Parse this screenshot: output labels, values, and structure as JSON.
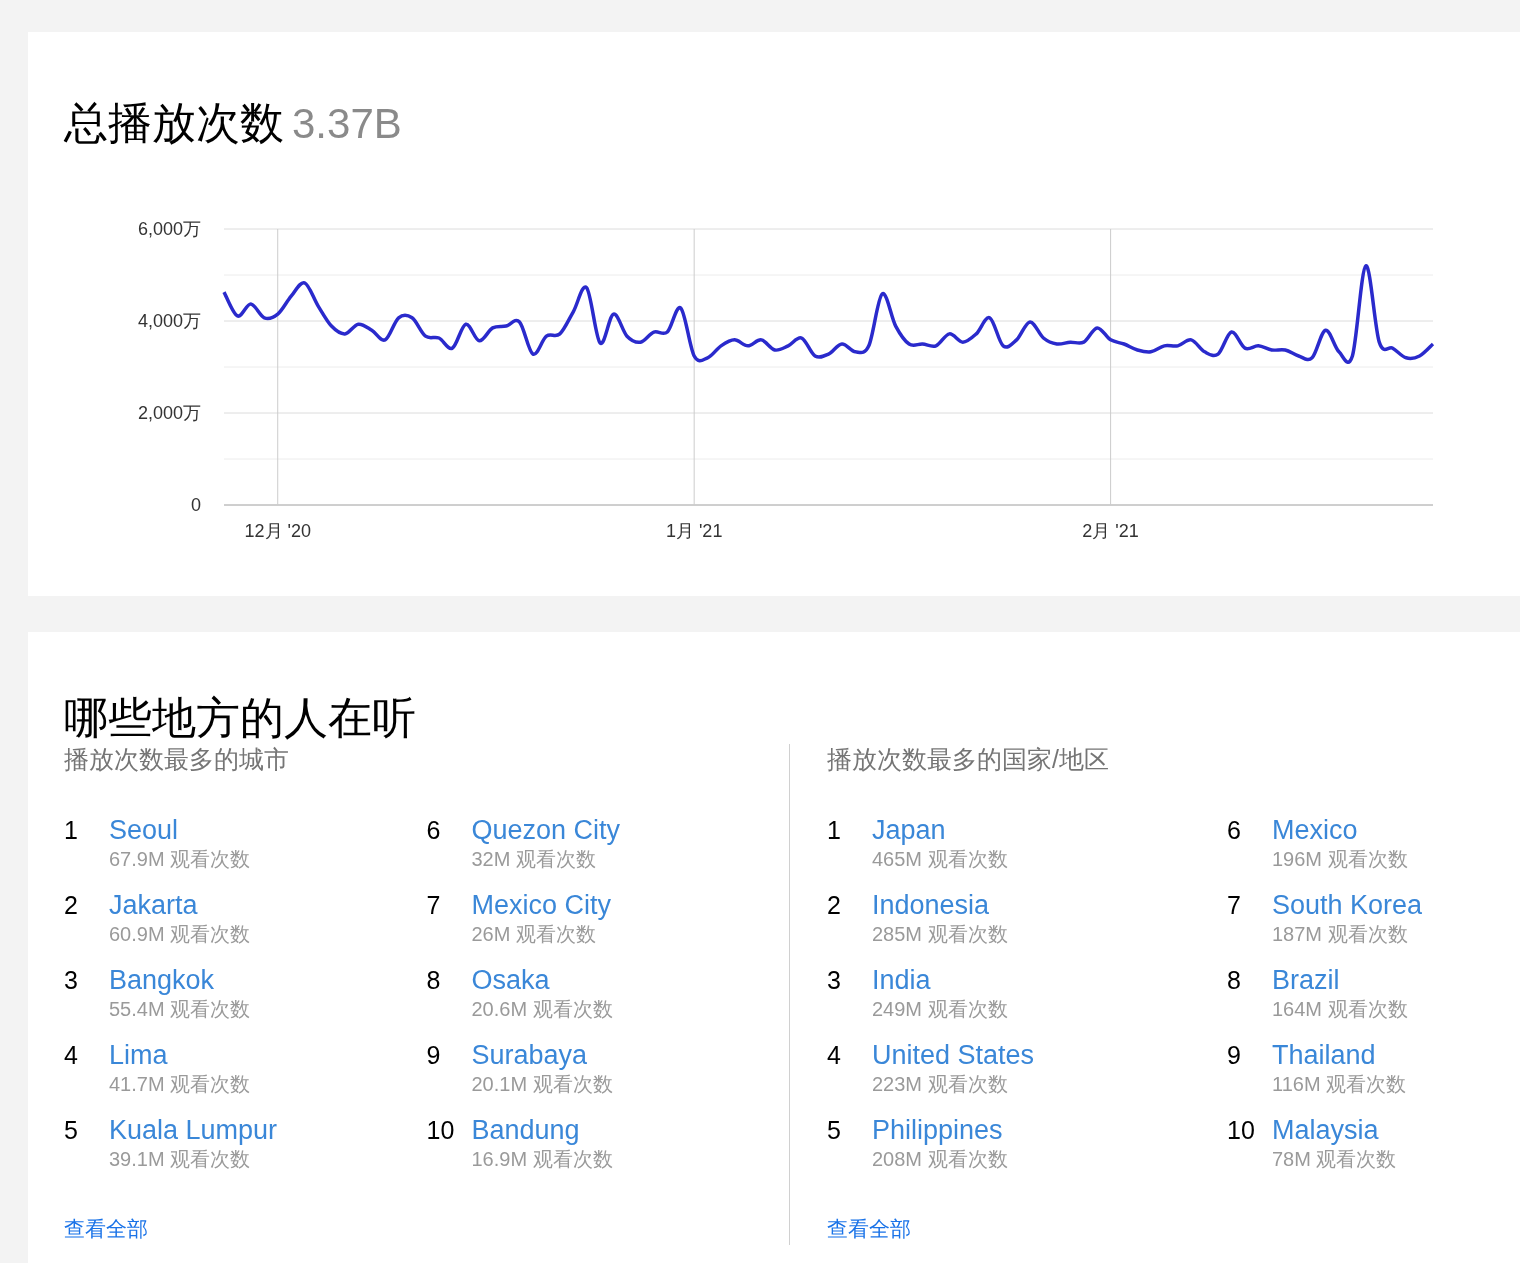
{
  "plays": {
    "title": "总播放次数",
    "total": "3.37B",
    "chart_data": {
      "type": "line",
      "grid": true,
      "ylim": [
        0,
        6000
      ],
      "categories": [
        null,
        null,
        null,
        null,
        "12月 '20",
        null,
        null,
        null,
        null,
        null,
        null,
        null,
        null,
        null,
        null,
        null,
        null,
        null,
        null,
        null,
        null,
        null,
        null,
        null,
        null,
        null,
        null,
        null,
        null,
        null,
        null,
        null,
        null,
        null,
        null,
        "1月 '21",
        null,
        null,
        null,
        null,
        null,
        null,
        null,
        null,
        null,
        null,
        null,
        null,
        null,
        null,
        null,
        null,
        null,
        null,
        null,
        null,
        null,
        null,
        null,
        null,
        null,
        null,
        null,
        null,
        null,
        null,
        "2月 '21",
        null,
        null,
        null,
        null,
        null,
        null,
        null,
        null,
        null,
        null,
        null,
        null,
        null,
        null,
        null,
        null,
        null,
        null,
        null,
        null,
        null,
        null,
        null,
        null
      ],
      "yticks": [
        {
          "value": 0,
          "label": "0"
        },
        {
          "value": 2000,
          "label": "2,000万"
        },
        {
          "value": 4000,
          "label": "4,000万"
        },
        {
          "value": 6000,
          "label": "6,000万"
        }
      ],
      "series": [
        {
          "color": "#2a2acc",
          "values": [
            4630,
            4110,
            4370,
            4070,
            4150,
            4540,
            4830,
            4330,
            3890,
            3720,
            3930,
            3800,
            3590,
            4070,
            4070,
            3670,
            3630,
            3410,
            3930,
            3570,
            3850,
            3890,
            3980,
            3280,
            3670,
            3720,
            4200,
            4720,
            3520,
            4150,
            3670,
            3540,
            3760,
            3760,
            4280,
            3240,
            3200,
            3460,
            3590,
            3460,
            3590,
            3370,
            3460,
            3630,
            3240,
            3280,
            3500,
            3330,
            3460,
            4590,
            3890,
            3500,
            3500,
            3460,
            3720,
            3540,
            3720,
            4070,
            3460,
            3590,
            3980,
            3630,
            3500,
            3540,
            3540,
            3850,
            3590,
            3500,
            3370,
            3330,
            3460,
            3460,
            3590,
            3330,
            3280,
            3760,
            3410,
            3460,
            3370,
            3370,
            3240,
            3200,
            3800,
            3330,
            3240,
            5200,
            3540,
            3410,
            3200,
            3240,
            3500
          ]
        }
      ]
    }
  },
  "where": {
    "title": "哪些地方的人在听",
    "groups": [
      {
        "subtitle": "播放次数最多的城市",
        "link": "查看全部",
        "items": [
          {
            "rank": "1",
            "name": "Seoul",
            "count": "67.9M 观看次数"
          },
          {
            "rank": "2",
            "name": "Jakarta",
            "count": "60.9M 观看次数"
          },
          {
            "rank": "3",
            "name": "Bangkok",
            "count": "55.4M 观看次数"
          },
          {
            "rank": "4",
            "name": "Lima",
            "count": "41.7M 观看次数"
          },
          {
            "rank": "5",
            "name": "Kuala Lumpur",
            "count": "39.1M 观看次数"
          },
          {
            "rank": "6",
            "name": "Quezon City",
            "count": "32M 观看次数"
          },
          {
            "rank": "7",
            "name": "Mexico City",
            "count": "26M 观看次数"
          },
          {
            "rank": "8",
            "name": "Osaka",
            "count": "20.6M 观看次数"
          },
          {
            "rank": "9",
            "name": "Surabaya",
            "count": "20.1M 观看次数"
          },
          {
            "rank": "10",
            "name": "Bandung",
            "count": "16.9M 观看次数"
          }
        ]
      },
      {
        "subtitle": "播放次数最多的国家/地区",
        "link": "查看全部",
        "items": [
          {
            "rank": "1",
            "name": "Japan",
            "count": "465M 观看次数"
          },
          {
            "rank": "2",
            "name": "Indonesia",
            "count": "285M 观看次数"
          },
          {
            "rank": "3",
            "name": "India",
            "count": "249M 观看次数"
          },
          {
            "rank": "4",
            "name": "United States",
            "count": "223M 观看次数"
          },
          {
            "rank": "5",
            "name": "Philippines",
            "count": "208M 观看次数"
          },
          {
            "rank": "6",
            "name": "Mexico",
            "count": "196M 观看次数"
          },
          {
            "rank": "7",
            "name": "South Korea",
            "count": "187M 观看次数"
          },
          {
            "rank": "8",
            "name": "Brazil",
            "count": "164M 观看次数"
          },
          {
            "rank": "9",
            "name": "Thailand",
            "count": "116M 观看次数"
          },
          {
            "rank": "10",
            "name": "Malaysia",
            "count": "78M 观看次数"
          }
        ]
      }
    ]
  }
}
